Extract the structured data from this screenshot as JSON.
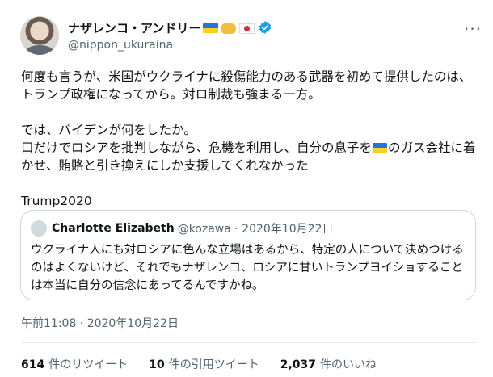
{
  "tweet": {
    "author_name": "ナザレンコ・アンドリー",
    "author_handle": "@nippon_ukuraina",
    "text_part1": "何度も言うが、米国がウクライナに殺傷能力のある武器を初めて提供したのは、トランプ政権になってから。対ロ制裁も強まる一方。\n\nでは、バイデンが何をしたか。\n口だけでロシアを批判しながら、危機を利用し、自分の息子を",
    "text_part2": "のガス会社に着かせ、賄賂と引き換えにしか支援してくれなかった\n\nTrump2020",
    "timestamp": "午前11:08 · 2020年10月22日"
  },
  "quote": {
    "author_name": "Charlotte Elizabeth",
    "meta": "@kozawa · 2020年10月22日",
    "text": "ウクライナ人にも対ロシアに色んな立場はあるから、特定の人について決めつけるのはよくないけど、それでもナザレンコ、ロシアに甘いトランプヨイショすることは本当に自分の信念にあってるんですかね。"
  },
  "stats": {
    "retweets_count": "614",
    "retweets_label": "件のリツイート",
    "quotes_count": "10",
    "quotes_label": "件の引用ツイート",
    "likes_count": "2,037",
    "likes_label": "件のいいね"
  },
  "icons": {
    "more": "more-icon",
    "verified": "verified-badge-icon"
  },
  "colors": {
    "verified_blue": "#1d9bf0",
    "secondary_text": "#536471",
    "border": "#cfd9de"
  }
}
